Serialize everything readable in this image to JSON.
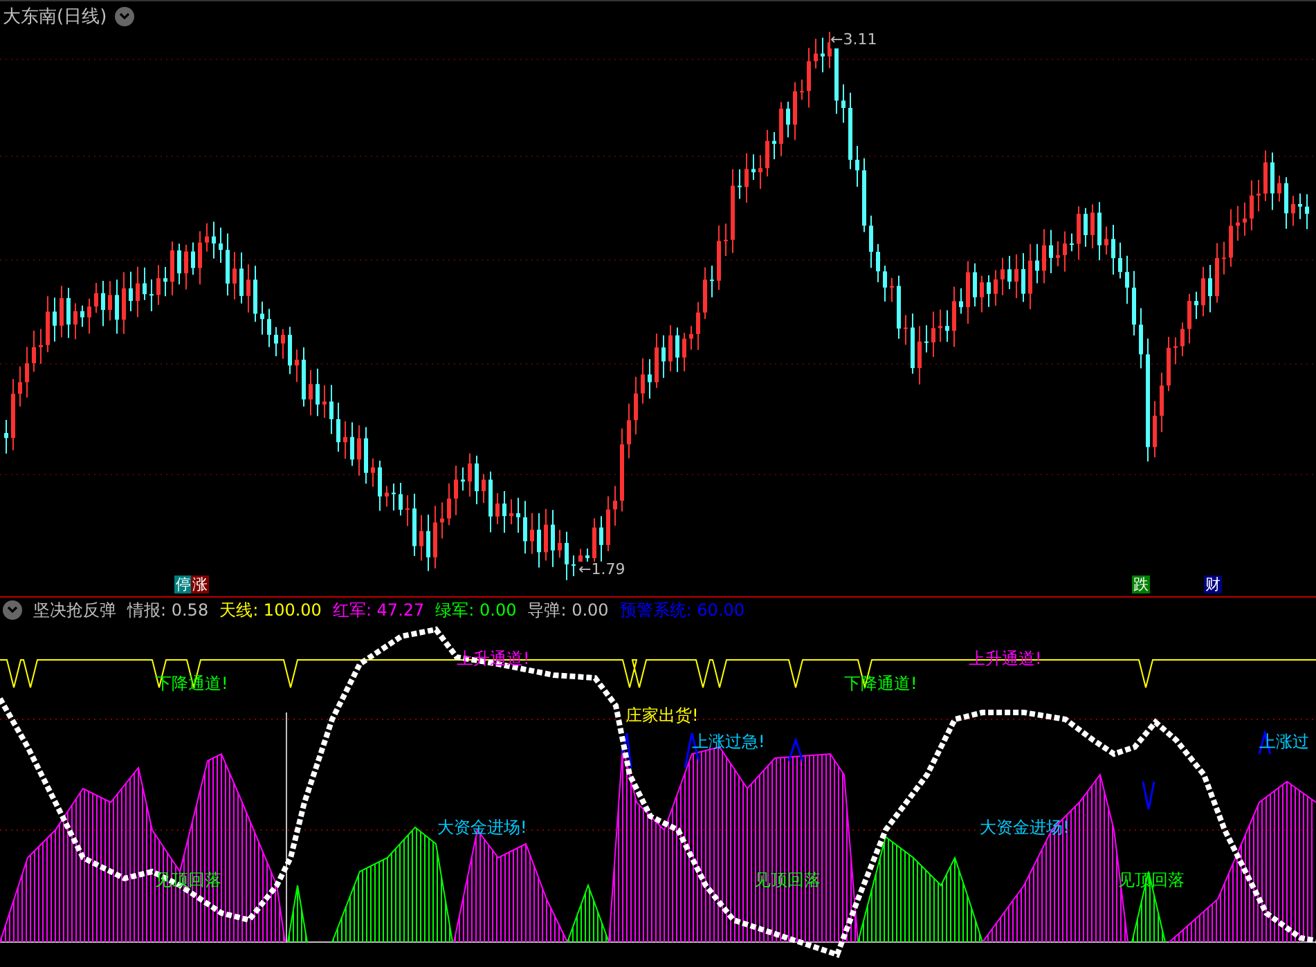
{
  "title": "大东南(日线)",
  "main_chart": {
    "high_label": "←3.11",
    "low_label": "←1.79",
    "signals": [
      {
        "text": "停",
        "color": "#007f7f"
      },
      {
        "text": "涨",
        "color": "#7f0000"
      },
      {
        "text": "跌",
        "color": "#007f00"
      },
      {
        "text": "财",
        "color": "#00007f"
      }
    ]
  },
  "indicator": {
    "name": "坚决抢反弹",
    "values": [
      {
        "label": "情报:",
        "value": "0.58",
        "color": "#c0c0c0"
      },
      {
        "label": "天线:",
        "value": "100.00",
        "color": "#ffff00"
      },
      {
        "label": "红军:",
        "value": "47.27",
        "color": "#ff00ff"
      },
      {
        "label": "绿军:",
        "value": "0.00",
        "color": "#00ff00"
      },
      {
        "label": "导弹:",
        "value": "0.00",
        "color": "#c0c0c0"
      },
      {
        "label": "预警系统:",
        "value": "60.00",
        "color": "#0000ff"
      }
    ],
    "annotations": [
      {
        "text": "下降通道!",
        "color": "#00ff00"
      },
      {
        "text": "上升通道!",
        "color": "#ff00ff"
      },
      {
        "text": "庄家出货!",
        "color": "#ffff00"
      },
      {
        "text": "上涨过急!",
        "color": "#00ccff"
      },
      {
        "text": "下降通道!",
        "color": "#00ff00"
      },
      {
        "text": "上升通道!",
        "color": "#ff00ff"
      },
      {
        "text": "上涨过",
        "color": "#00ccff"
      },
      {
        "text": "大资金进场!",
        "color": "#00ccff"
      },
      {
        "text": "大资金进场!",
        "color": "#00ccff"
      },
      {
        "text": "见顶回落",
        "color": "#00ff00"
      },
      {
        "text": "见顶回落",
        "color": "#00ff00"
      },
      {
        "text": "见顶回落",
        "color": "#00ff00"
      }
    ]
  }
}
